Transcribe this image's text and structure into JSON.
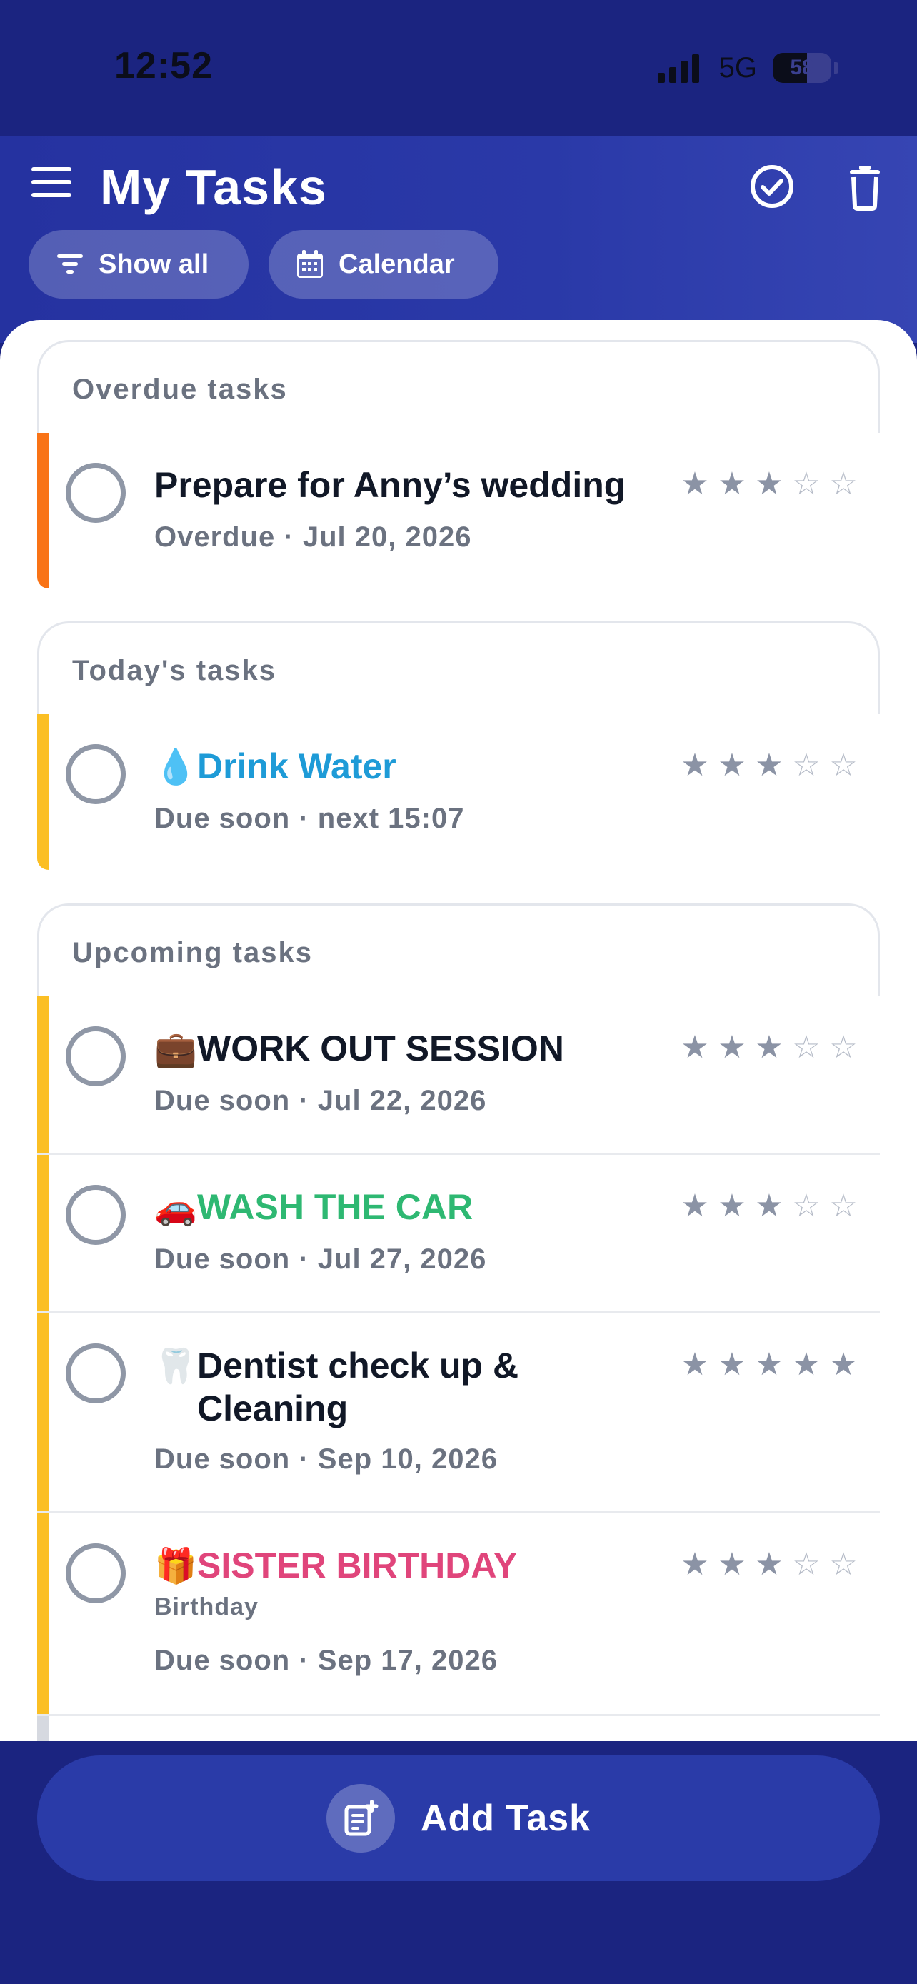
{
  "status_bar": {
    "time": "12:52",
    "network": "5G",
    "battery": "58",
    "battery_level": 0.58
  },
  "header": {
    "title": "My Tasks",
    "chips": [
      {
        "label": "Show all",
        "icon": "filter-icon"
      },
      {
        "label": "Calendar",
        "icon": "calendar-icon"
      }
    ],
    "icons": [
      "check-circle-icon",
      "trash-icon"
    ]
  },
  "sections": [
    {
      "heading": "Overdue tasks",
      "tasks": [
        {
          "emoji": "",
          "title": "Prepare for Anny’s wedding",
          "title_color": "#111827",
          "subtitle": "Overdue · Jul 20, 2026",
          "rating": 3,
          "bar_color": "#f97316"
        }
      ]
    },
    {
      "heading": "Today's tasks",
      "tasks": [
        {
          "emoji": "💧",
          "title": "Drink Water",
          "title_color": "#1e9bd7",
          "subtitle": "Due soon · next 15:07",
          "rating": 3,
          "bar_color": "#fbbf24"
        }
      ]
    },
    {
      "heading": "Upcoming tasks",
      "tasks": [
        {
          "emoji": "💼",
          "title": "WORK OUT SESSION",
          "title_color": "#111827",
          "subtitle": "Due soon · Jul 22, 2026",
          "rating": 3,
          "bar_color": "#fbbf24"
        },
        {
          "emoji": "🚗",
          "title": "WASH THE CAR",
          "title_color": "#2eb872",
          "subtitle": "Due soon · Jul 27, 2026",
          "rating": 3,
          "bar_color": "#fbbf24"
        },
        {
          "emoji": "🦷",
          "title_line1": "Dentist check up &",
          "title_line2": "Cleaning",
          "title_color": "#111827",
          "subtitle": "Due soon · Sep 10, 2026",
          "rating": 5,
          "bar_color": "#fbbf24"
        },
        {
          "emoji": "🎁",
          "title": "SISTER BIRTHDAY",
          "title_color": "#e0457b",
          "tag": "Birthday",
          "subtitle": "Due soon · Sep 17, 2026",
          "rating": 3,
          "bar_color": "#fbbf24"
        }
      ]
    }
  ],
  "add_task": {
    "label": "Add Task",
    "icon": "add-note-icon"
  },
  "colors": {
    "background": "#1b2480",
    "header": "#2a39a8",
    "accent": "#2a3ba8",
    "overdue": "#f97316",
    "due_soon": "#fbbf24"
  }
}
